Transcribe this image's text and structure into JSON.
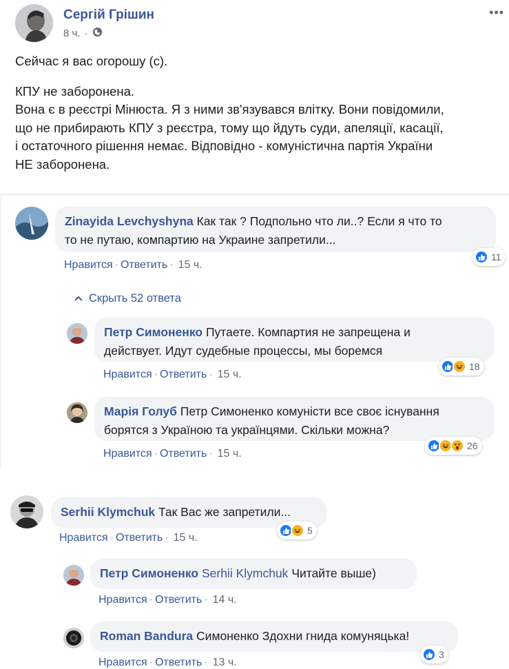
{
  "post": {
    "author": "Сергій Грішин",
    "time": "8 ч.",
    "audience_icon": "globe-icon",
    "more_icon": "more-options-icon",
    "line1": "Сейчас я вас огорошу (с).",
    "line2": "КПУ не заборонена.",
    "line3": "Вона є в реєстрі Мінюста. Я з ними зв'язувався влітку. Вони повідомили,",
    "line4": "що не прибирають КПУ з реєстра, тому що йдуть суди, апеляції, касації,",
    "line5": "і остаточного рішення немає. Відповідно - комуністична партія України",
    "line6": "НЕ заборонена."
  },
  "labels": {
    "like": "Нравится",
    "reply": "Ответить",
    "dot": "·"
  },
  "comments": [
    {
      "author": "Zinayida Levchyshyna",
      "text1": "Как так ? Подпольно что ли..? Если я что то",
      "text2": "то не путаю, компартию на Украине запретили...",
      "time": "15 ч.",
      "reaction_count": "11",
      "reactions": [
        "like"
      ]
    },
    {
      "author": "Serhii Klymchuk",
      "text1": "Так Вас же запретили...",
      "time": "15 ч.",
      "reaction_count": "5",
      "reactions": [
        "like",
        "haha"
      ]
    }
  ],
  "hide_replies": "Скрыть 52 ответа",
  "replies": [
    {
      "author": "Петр Симоненко",
      "text1": "Путаете. Компартия не запрещена и",
      "text2": "действует. Идут судебные процессы, мы боремся",
      "time": "15 ч.",
      "reaction_count": "18",
      "reactions": [
        "like",
        "haha"
      ]
    },
    {
      "author": "Марія Голуб",
      "text1": "Петр Симоненко комуністи все своє існування",
      "text2": "борятся з Україною та українцями. Скільки можна?",
      "time": "15 ч.",
      "reaction_count": "26",
      "reactions": [
        "like",
        "haha",
        "wow"
      ]
    },
    {
      "author": "Петр Симоненко",
      "mention": "Serhii Klymchuk",
      "text1": "Читайте выше)",
      "time": "14 ч."
    },
    {
      "author": "Roman Bandura",
      "text1": "Симоненко Здохни гнида комуняцька!",
      "time": "13 ч.",
      "reaction_count": "3",
      "reactions": [
        "like"
      ]
    }
  ],
  "colors": {
    "link": "#385898",
    "bubble": "#f2f3f5",
    "like": "#1877f2",
    "haha": "#f7b125"
  }
}
